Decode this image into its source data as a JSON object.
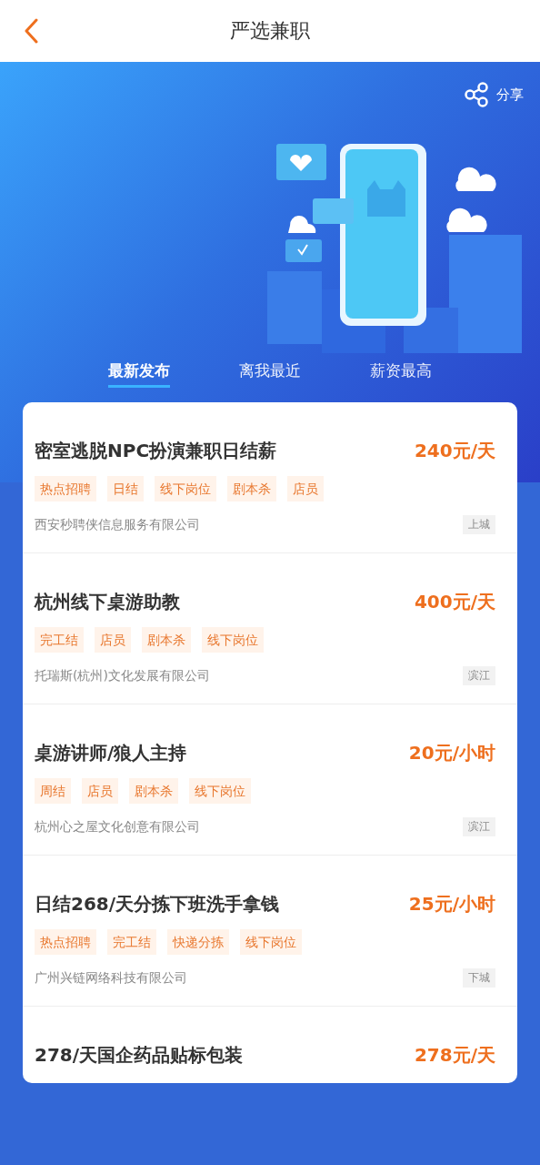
{
  "header": {
    "title": "严选兼职"
  },
  "banner": {
    "share_label": "分享"
  },
  "tabs": [
    {
      "label": "最新发布",
      "selected": true
    },
    {
      "label": "离我最近",
      "selected": false
    },
    {
      "label": "薪资最高",
      "selected": false
    }
  ],
  "jobs": [
    {
      "title": "密室逃脱NPC扮演兼职日结薪",
      "salary": "240元/天",
      "tags": [
        "热点招聘",
        "日结",
        "线下岗位",
        "剧本杀",
        "店员"
      ],
      "company": "西安秒聘侠信息服务有限公司",
      "district": "上城"
    },
    {
      "title": "杭州线下桌游助教",
      "salary": "400元/天",
      "tags": [
        "完工结",
        "店员",
        "剧本杀",
        "线下岗位"
      ],
      "company": "托瑞斯(杭州)文化发展有限公司",
      "district": "滨江"
    },
    {
      "title": "桌游讲师/狼人主持",
      "salary": "20元/小时",
      "tags": [
        "周结",
        "店员",
        "剧本杀",
        "线下岗位"
      ],
      "company": "杭州心之屋文化创意有限公司",
      "district": "滨江"
    },
    {
      "title": "日结268/天分拣下班洗手拿钱",
      "salary": "25元/小时",
      "tags": [
        "热点招聘",
        "完工结",
        "快递分拣",
        "线下岗位"
      ],
      "company": "广州兴链网络科技有限公司",
      "district": "下城"
    },
    {
      "title": "278/天国企药品贴标包装",
      "salary": "278元/天"
    }
  ]
}
